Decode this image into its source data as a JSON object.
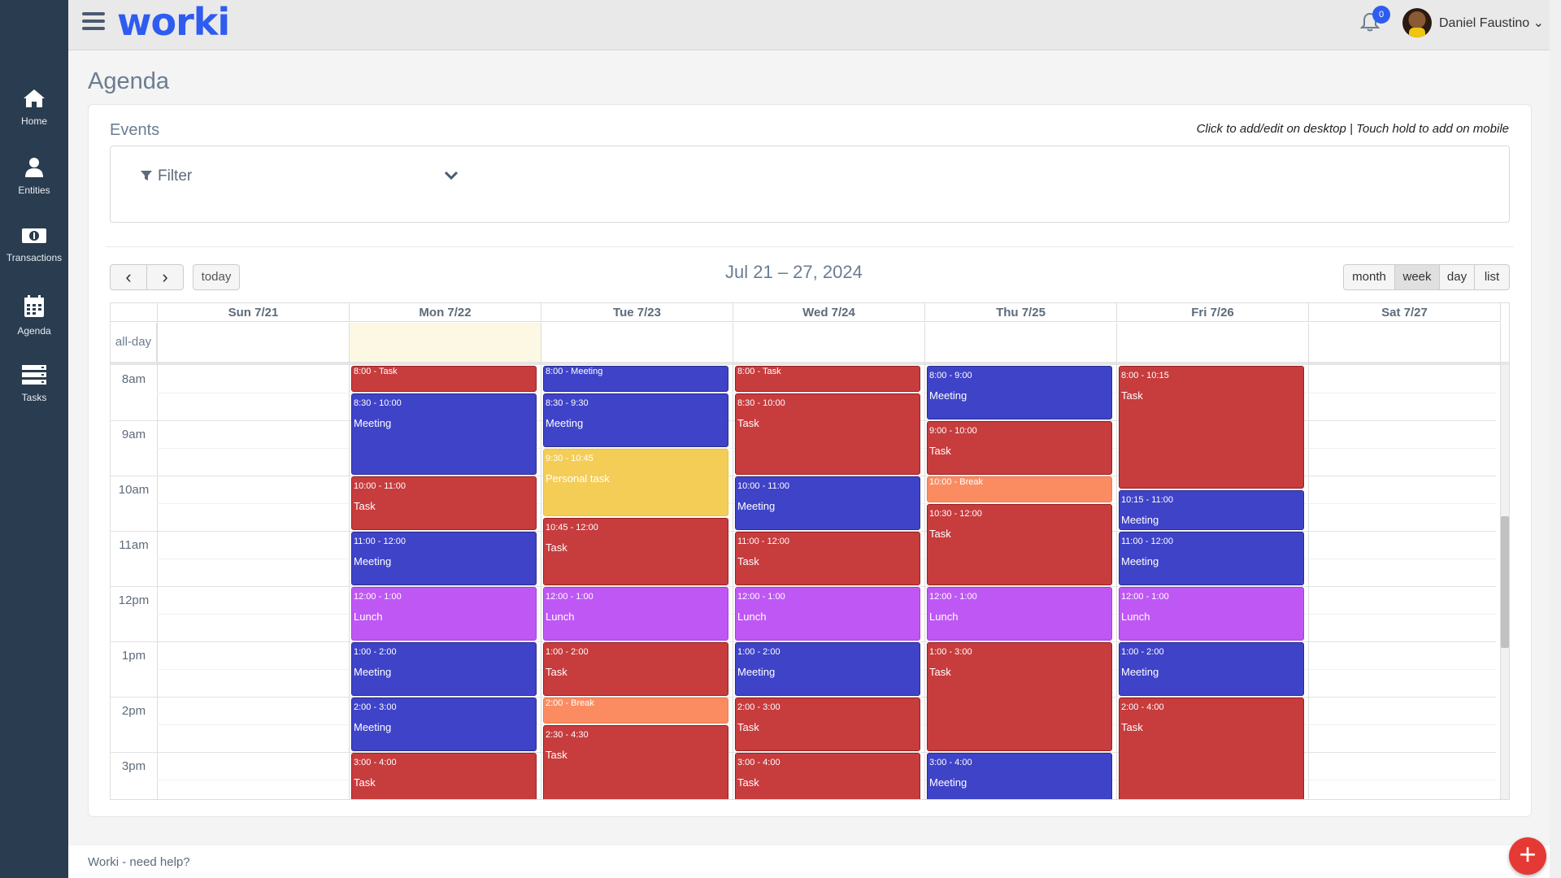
{
  "sidebar": {
    "items": [
      {
        "label": "Home",
        "icon": "home-icon"
      },
      {
        "label": "Entities",
        "icon": "user-icon"
      },
      {
        "label": "Transactions",
        "icon": "money-icon"
      },
      {
        "label": "Agenda",
        "icon": "calendar-icon"
      },
      {
        "label": "Tasks",
        "icon": "tasks-icon"
      }
    ]
  },
  "header": {
    "logo": "worki",
    "notifications_count": "0",
    "user_name": "Daniel Faustino",
    "user_chevron": "⌄"
  },
  "page": {
    "title": "Agenda",
    "events_title": "Events",
    "hint": "Click to add/edit on desktop | Touch hold to add on mobile",
    "filter_label": "Filter"
  },
  "toolbar": {
    "prev": "‹",
    "next": "›",
    "today": "today",
    "range": "Jul 21 – 27, 2024",
    "views": [
      "month",
      "week",
      "day",
      "list"
    ],
    "active_view": "week"
  },
  "calendar": {
    "days": [
      "Sun 7/21",
      "Mon 7/22",
      "Tue 7/23",
      "Wed 7/24",
      "Thu 7/25",
      "Fri 7/26",
      "Sat 7/27"
    ],
    "today_index": 1,
    "allday_label": "all-day",
    "hours": [
      "8am",
      "9am",
      "10am",
      "11am",
      "12pm",
      "1pm",
      "2pm",
      "3pm"
    ],
    "events": [
      {
        "day": 1,
        "time": "8:00 - Task",
        "name": "",
        "start": 8.0,
        "end": 8.5,
        "type": "task"
      },
      {
        "day": 1,
        "time": "8:30 - 10:00",
        "name": "Meeting",
        "start": 8.5,
        "end": 10.0,
        "type": "meeting"
      },
      {
        "day": 1,
        "time": "10:00 - 11:00",
        "name": "Task",
        "start": 10.0,
        "end": 11.0,
        "type": "task"
      },
      {
        "day": 1,
        "time": "11:00 - 12:00",
        "name": "Meeting",
        "start": 11.0,
        "end": 12.0,
        "type": "meeting"
      },
      {
        "day": 1,
        "time": "12:00 - 1:00",
        "name": "Lunch",
        "start": 12.0,
        "end": 13.0,
        "type": "lunch"
      },
      {
        "day": 1,
        "time": "1:00 - 2:00",
        "name": "Meeting",
        "start": 13.0,
        "end": 14.0,
        "type": "meeting"
      },
      {
        "day": 1,
        "time": "2:00 - 3:00",
        "name": "Meeting",
        "start": 14.0,
        "end": 15.0,
        "type": "meeting"
      },
      {
        "day": 1,
        "time": "3:00 - 4:00",
        "name": "Task",
        "start": 15.0,
        "end": 16.0,
        "type": "task"
      },
      {
        "day": 2,
        "time": "8:00 - Meeting",
        "name": "",
        "start": 8.0,
        "end": 8.5,
        "type": "meeting"
      },
      {
        "day": 2,
        "time": "8:30 - 9:30",
        "name": "Meeting",
        "start": 8.5,
        "end": 9.5,
        "type": "meeting"
      },
      {
        "day": 2,
        "time": "9:30 - 10:45",
        "name": "Personal task",
        "start": 9.5,
        "end": 10.75,
        "type": "personal"
      },
      {
        "day": 2,
        "time": "10:45 - 12:00",
        "name": "Task",
        "start": 10.75,
        "end": 12.0,
        "type": "task"
      },
      {
        "day": 2,
        "time": "12:00 - 1:00",
        "name": "Lunch",
        "start": 12.0,
        "end": 13.0,
        "type": "lunch"
      },
      {
        "day": 2,
        "time": "1:00 - 2:00",
        "name": "Task",
        "start": 13.0,
        "end": 14.0,
        "type": "task"
      },
      {
        "day": 2,
        "time": "2:00 - Break",
        "name": "",
        "start": 14.0,
        "end": 14.5,
        "type": "break"
      },
      {
        "day": 2,
        "time": "2:30 - 4:30",
        "name": "Task",
        "start": 14.5,
        "end": 16.5,
        "type": "task"
      },
      {
        "day": 3,
        "time": "8:00 - Task",
        "name": "",
        "start": 8.0,
        "end": 8.5,
        "type": "task"
      },
      {
        "day": 3,
        "time": "8:30 - 10:00",
        "name": "Task",
        "start": 8.5,
        "end": 10.0,
        "type": "task"
      },
      {
        "day": 3,
        "time": "10:00 - 11:00",
        "name": "Meeting",
        "start": 10.0,
        "end": 11.0,
        "type": "meeting"
      },
      {
        "day": 3,
        "time": "11:00 - 12:00",
        "name": "Task",
        "start": 11.0,
        "end": 12.0,
        "type": "task"
      },
      {
        "day": 3,
        "time": "12:00 - 1:00",
        "name": "Lunch",
        "start": 12.0,
        "end": 13.0,
        "type": "lunch"
      },
      {
        "day": 3,
        "time": "1:00 - 2:00",
        "name": "Meeting",
        "start": 13.0,
        "end": 14.0,
        "type": "meeting"
      },
      {
        "day": 3,
        "time": "2:00 - 3:00",
        "name": "Task",
        "start": 14.0,
        "end": 15.0,
        "type": "task"
      },
      {
        "day": 3,
        "time": "3:00 - 4:00",
        "name": "Task",
        "start": 15.0,
        "end": 16.0,
        "type": "task"
      },
      {
        "day": 4,
        "time": "8:00 - 9:00",
        "name": "Meeting",
        "start": 8.0,
        "end": 9.0,
        "type": "meeting"
      },
      {
        "day": 4,
        "time": "9:00 - 10:00",
        "name": "Task",
        "start": 9.0,
        "end": 10.0,
        "type": "task"
      },
      {
        "day": 4,
        "time": "10:00 - Break",
        "name": "",
        "start": 10.0,
        "end": 10.5,
        "type": "break"
      },
      {
        "day": 4,
        "time": "10:30 - 12:00",
        "name": "Task",
        "start": 10.5,
        "end": 12.0,
        "type": "task"
      },
      {
        "day": 4,
        "time": "12:00 - 1:00",
        "name": "Lunch",
        "start": 12.0,
        "end": 13.0,
        "type": "lunch"
      },
      {
        "day": 4,
        "time": "1:00 - 3:00",
        "name": "Task",
        "start": 13.0,
        "end": 15.0,
        "type": "task"
      },
      {
        "day": 4,
        "time": "3:00 - 4:00",
        "name": "Meeting",
        "start": 15.0,
        "end": 16.0,
        "type": "meeting"
      },
      {
        "day": 5,
        "time": "8:00 - 10:15",
        "name": "Task",
        "start": 8.0,
        "end": 10.25,
        "type": "task"
      },
      {
        "day": 5,
        "time": "10:15 - 11:00",
        "name": "Meeting",
        "start": 10.25,
        "end": 11.0,
        "type": "meeting"
      },
      {
        "day": 5,
        "time": "11:00 - 12:00",
        "name": "Meeting",
        "start": 11.0,
        "end": 12.0,
        "type": "meeting"
      },
      {
        "day": 5,
        "time": "12:00 - 1:00",
        "name": "Lunch",
        "start": 12.0,
        "end": 13.0,
        "type": "lunch"
      },
      {
        "day": 5,
        "time": "1:00 - 2:00",
        "name": "Meeting",
        "start": 13.0,
        "end": 14.0,
        "type": "meeting"
      },
      {
        "day": 5,
        "time": "2:00 - 4:00",
        "name": "Task",
        "start": 14.0,
        "end": 16.0,
        "type": "task"
      }
    ]
  },
  "footer": {
    "text": "Worki - need help?",
    "fab": "+"
  },
  "colors": {
    "sidebar": "#2a3c4f",
    "brand": "#2f5cf0",
    "task": "#c73c3d",
    "meeting": "#3f43c8",
    "lunch": "#bf57f5",
    "personal": "#f4cd57",
    "break": "#fb8c62",
    "today_bg": "#fcf8e3",
    "fab": "#e53935"
  }
}
